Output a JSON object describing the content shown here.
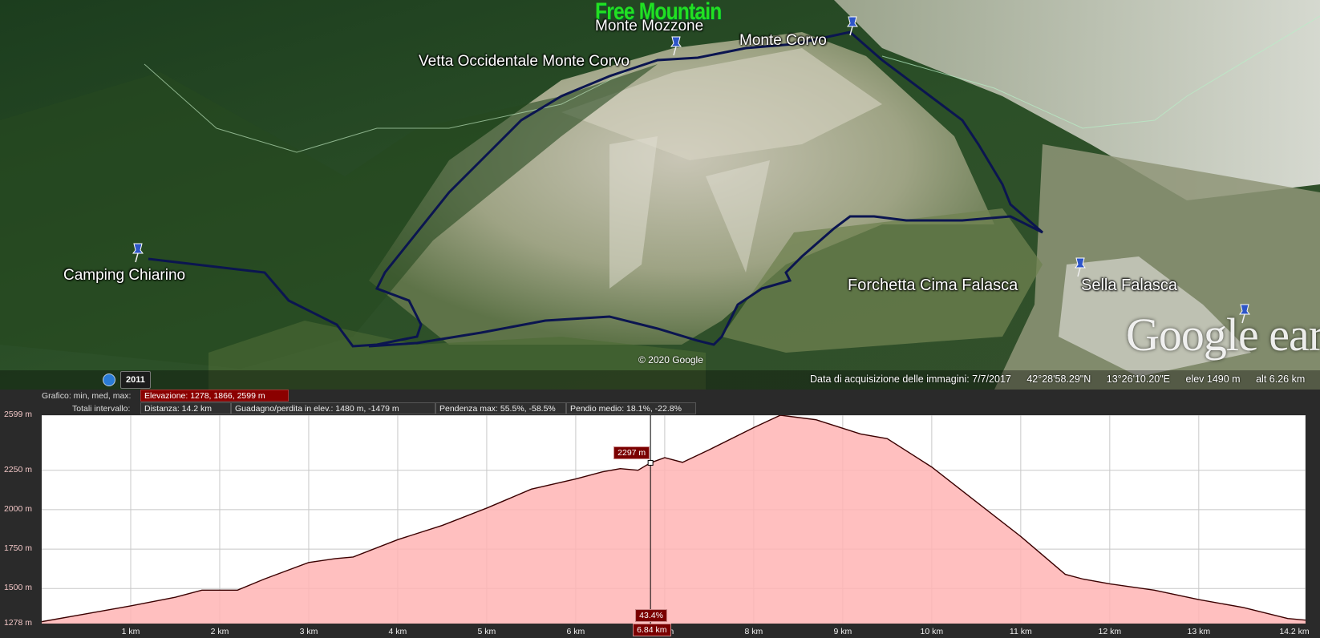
{
  "map": {
    "watermark": "Free Mountain",
    "places": {
      "monte_mozzone": "Monte Mozzone",
      "monte_corvo": "Monte Corvo",
      "vetta_occidentale": "Vetta Occidentale Monte Corvo",
      "camping_chiarino": "Camping Chiarino",
      "forchetta_cima_falasca": "Forchetta Cima Falasca",
      "sella_falasca": "Sella Falasca"
    },
    "copyright": "© 2020 Google",
    "logo": "Google earth",
    "history_year": "2011",
    "status": {
      "acquisition": "Data di acquisizione delle immagini: 7/7/2017",
      "lat": "42°28'58.29\"N",
      "lon": "13°26'10.20\"E",
      "elev": "elev  1490 m",
      "alt": "alt   6.26 km"
    },
    "colors": {
      "track": "#0b1550",
      "pin": "#2d55c8"
    }
  },
  "profile": {
    "graph_label": "Grafico: min, med, max:",
    "elevation": "Elevazione: 1278, 1866, 2599 m",
    "totals_label": "Totali intervallo:",
    "distance": "Distanza: 14.2 km",
    "gain_loss": "Guadagno/perdita in elev.: 1480 m, -1479 m",
    "max_slope": "Pendenza max: 55.5%, -58.5%",
    "avg_slope": "Pendio medio: 18.1%, -22.8%",
    "cursor_elev": "2297 m",
    "cursor_slope": "43.4%",
    "cursor_dist": "6.84 km",
    "colors": {
      "fill": "#ffb4b4",
      "line": "#3a0000",
      "flag": "#7a0000"
    }
  },
  "chart_data": {
    "type": "area",
    "title": "",
    "xlabel": "",
    "ylabel": "",
    "x_unit": "km",
    "y_unit": "m",
    "xlim": [
      0,
      14.2
    ],
    "ylim": [
      1278,
      2599
    ],
    "y_ticks": [
      1278,
      1500,
      1750,
      2000,
      2250,
      2599
    ],
    "y_tick_labels": [
      "1278 m",
      "1500 m",
      "1750 m",
      "2000 m",
      "2250 m",
      "2599 m"
    ],
    "x_ticks": [
      1,
      2,
      3,
      4,
      5,
      6,
      7,
      8,
      9,
      10,
      11,
      12,
      13,
      14.2
    ],
    "x_tick_labels": [
      "1 km",
      "2 km",
      "3 km",
      "4 km",
      "5 km",
      "6 km",
      "7 km",
      "8 km",
      "9 km",
      "10 km",
      "11 km",
      "12 km",
      "13 km",
      "14.2 km"
    ],
    "grid": true,
    "series": [
      {
        "x": [
          0,
          0.5,
          1,
          1.5,
          1.8,
          2.2,
          2.5,
          3,
          3.3,
          3.5,
          4,
          4.5,
          5,
          5.5,
          6,
          6.3,
          6.5,
          6.7,
          6.84,
          7,
          7.2,
          7.5,
          8,
          8.3,
          8.7,
          9.2,
          9.5,
          10,
          10.5,
          11,
          11.5,
          11.7,
          12,
          12.5,
          13,
          13.5,
          14,
          14.2
        ],
        "y": [
          1290,
          1340,
          1390,
          1445,
          1490,
          1490,
          1560,
          1665,
          1690,
          1700,
          1810,
          1900,
          2010,
          2130,
          2195,
          2240,
          2260,
          2250,
          2297,
          2330,
          2300,
          2380,
          2520,
          2599,
          2570,
          2480,
          2450,
          2270,
          2050,
          1830,
          1590,
          1560,
          1530,
          1490,
          1430,
          1380,
          1310,
          1300
        ]
      }
    ]
  }
}
